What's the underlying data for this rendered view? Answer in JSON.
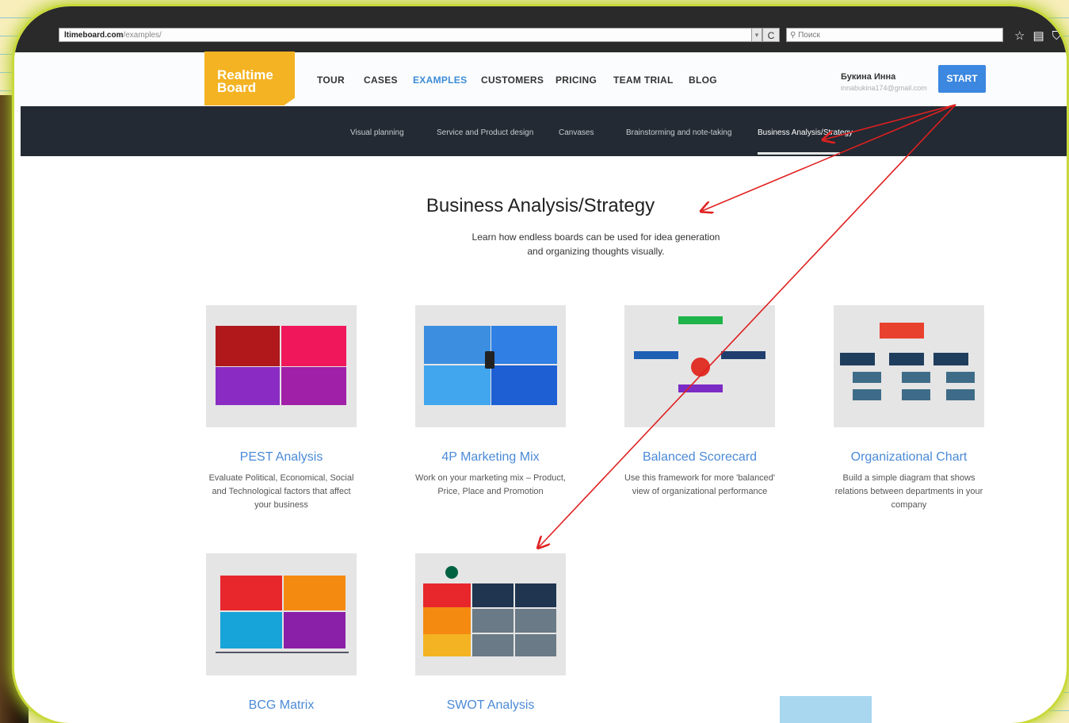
{
  "browser": {
    "url_host": "ltimeboard.com",
    "url_path": "/examples/",
    "reload_label": "C",
    "search_placeholder": "Поиск"
  },
  "site": {
    "logo_line1": "Realtime",
    "logo_line2": "Board",
    "nav": [
      "TOUR",
      "CASES",
      "EXAMPLES",
      "CUSTOMERS",
      "PRICING",
      "TEAM TRIAL",
      "BLOG"
    ],
    "active_nav": "EXAMPLES",
    "user_name": "Букина Инна",
    "user_email": "innabukina174@gmail.com",
    "start_label": "START"
  },
  "subnav": [
    "Visual planning",
    "Service and Product design",
    "Canvases",
    "Brainstorming and note-taking",
    "Business Analysis/Strategy"
  ],
  "section": {
    "title": "Business Analysis/Strategy",
    "subtitle_line1": "Learn how endless boards can be used for idea generation",
    "subtitle_line2": "and organizing thoughts visually."
  },
  "cards": [
    {
      "title": "PEST Analysis",
      "desc": "Evaluate Political, Economical, Social and Technological factors that affect your business"
    },
    {
      "title": "4P Marketing Mix",
      "desc": "Work on your marketing mix – Product, Price, Place and Promotion"
    },
    {
      "title": "Balanced Scorecard",
      "desc": "Use this framework for more 'balanced' view of organizational performance"
    },
    {
      "title": "Organizational Chart",
      "desc": "Build a simple diagram that shows relations between departments in your company"
    },
    {
      "title": "BCG Matrix",
      "desc": ""
    },
    {
      "title": "SWOT Analysis",
      "desc": ""
    }
  ],
  "colors": {
    "accent_blue": "#3c87e0",
    "logo_yellow": "#f4b323",
    "subnav_bg": "#232a33",
    "annotation_red": "#e02020"
  }
}
